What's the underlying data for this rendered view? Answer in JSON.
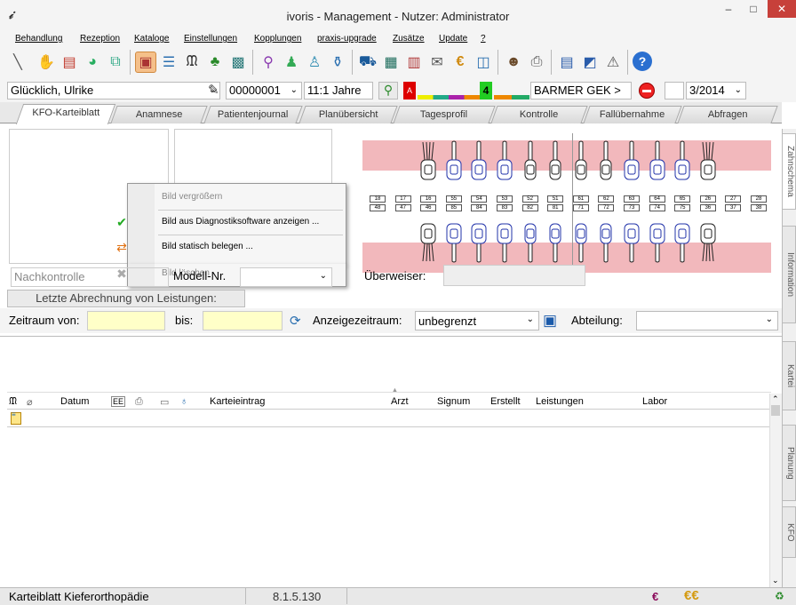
{
  "window": {
    "title": "ivoris - Management - Nutzer: Administrator",
    "minimize": "–",
    "maximize": "□",
    "close": "✕"
  },
  "menu": [
    "Behandlung",
    "Rezeption",
    "Kataloge",
    "Einstellungen",
    "Kopplungen",
    "praxis-upgrade",
    "Zusätze",
    "Update",
    "?"
  ],
  "patient": {
    "name": "Glücklich, Ulrike",
    "number": "00000001",
    "age": "11:1 Jahre",
    "insurance": "BARMER GEK >",
    "quarter": "3/2014",
    "badge_a": "A",
    "badge_4": "4"
  },
  "tabs": [
    "KFO-Karteiblatt",
    "Anamnese",
    "Patientenjournal",
    "Planübersicht",
    "Tagesprofil",
    "Kontrolle",
    "Fallübernahme",
    "Abfragen"
  ],
  "side_tabs": [
    "Zahnschema",
    "Information",
    "Kartei",
    "Planung",
    "KFO"
  ],
  "context_menu": [
    {
      "label": "Bild vergrößern",
      "enabled": false,
      "icon": ""
    },
    {
      "label": "Bild aus Diagnostiksoftware anzeigen ...",
      "enabled": true,
      "icon": "checkmark-icon"
    },
    {
      "label": "Bild statisch belegen ...",
      "enabled": true,
      "icon": "swap-icon"
    },
    {
      "label": "Bild löschen",
      "enabled": false,
      "icon": "delete-icon"
    }
  ],
  "teeth": {
    "upper_numbers": [
      "18",
      "17",
      "16",
      "55",
      "54",
      "53",
      "52",
      "51",
      "61",
      "62",
      "63",
      "64",
      "65",
      "26",
      "27",
      "28"
    ],
    "lower_numbers": [
      "48",
      "47",
      "46",
      "85",
      "84",
      "83",
      "82",
      "81",
      "71",
      "72",
      "73",
      "74",
      "75",
      "36",
      "37",
      "38"
    ]
  },
  "form": {
    "nachkontrolle": "Nachkontrolle",
    "modell_label": "Modell-Nr.",
    "ueberweiser_label": "Überweiser:",
    "abrechnung_button": "Letzte Abrechnung von Leistungen:",
    "zeitraum_label": "Zeitraum von:",
    "bis_label": "bis:",
    "anzeige_label": "Anzeigezeitraum:",
    "anzeige_value": "unbegrenzt",
    "abteilung_label": "Abteilung:"
  },
  "grid_columns": [
    "Datum",
    "Karteieintrag",
    "Arzt",
    "Signum",
    "Erstellt",
    "Leistungen",
    "Labor"
  ],
  "status": {
    "left": "Karteiblatt Kieferorthopädie",
    "version": "8.1.5.130",
    "euro1": "€",
    "euro2": "€€"
  },
  "colors": {
    "gum": "#f2b8bc",
    "accent_blue": "#2a5caa",
    "tooth_blue": "#2233aa"
  }
}
